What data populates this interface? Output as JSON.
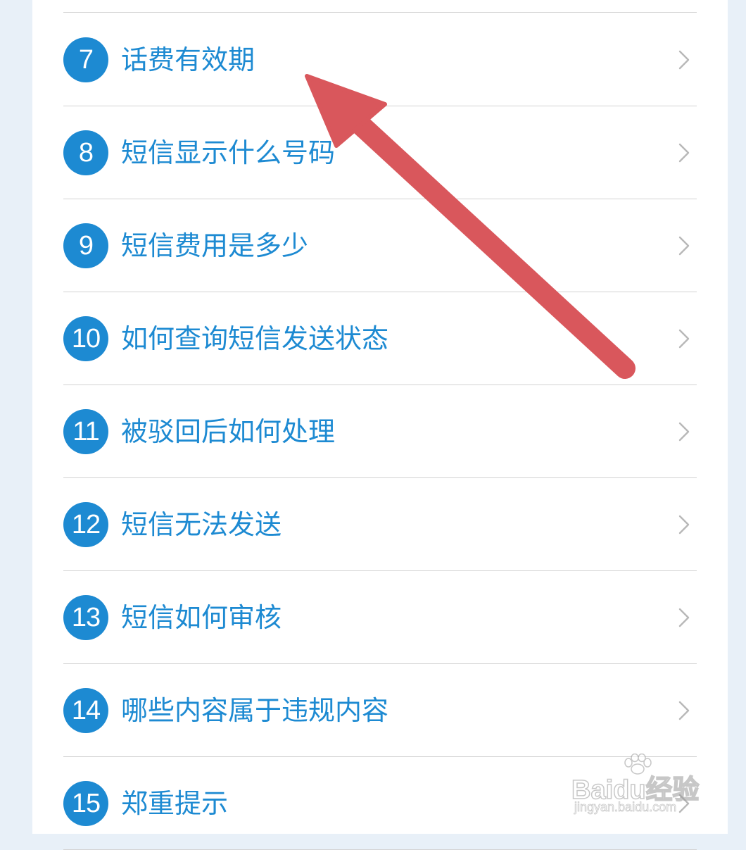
{
  "colors": {
    "accent": "#1d8ad2",
    "badge": "#1d8ad2",
    "divider": "#d2d2d2",
    "chevron": "#b8b8b8",
    "background": "#e8f0f8",
    "card": "#ffffff",
    "annotation_arrow": "#d9575c"
  },
  "items": [
    {
      "number": "7",
      "label": "话费有效期",
      "icon": "chevron-right-icon"
    },
    {
      "number": "8",
      "label": "短信显示什么号码",
      "icon": "chevron-right-icon"
    },
    {
      "number": "9",
      "label": "短信费用是多少",
      "icon": "chevron-right-icon"
    },
    {
      "number": "10",
      "label": "如何查询短信发送状态",
      "icon": "chevron-right-icon"
    },
    {
      "number": "11",
      "label": "被驳回后如何处理",
      "icon": "chevron-right-icon"
    },
    {
      "number": "12",
      "label": "短信无法发送",
      "icon": "chevron-right-icon"
    },
    {
      "number": "13",
      "label": "短信如何审核",
      "icon": "chevron-right-icon"
    },
    {
      "number": "14",
      "label": "哪些内容属于违规内容",
      "icon": "chevron-right-icon"
    },
    {
      "number": "15",
      "label": "郑重提示",
      "icon": "chevron-right-icon"
    }
  ],
  "watermark": {
    "logo": "Baidu经验",
    "url": "jingyan.baidu.com"
  }
}
